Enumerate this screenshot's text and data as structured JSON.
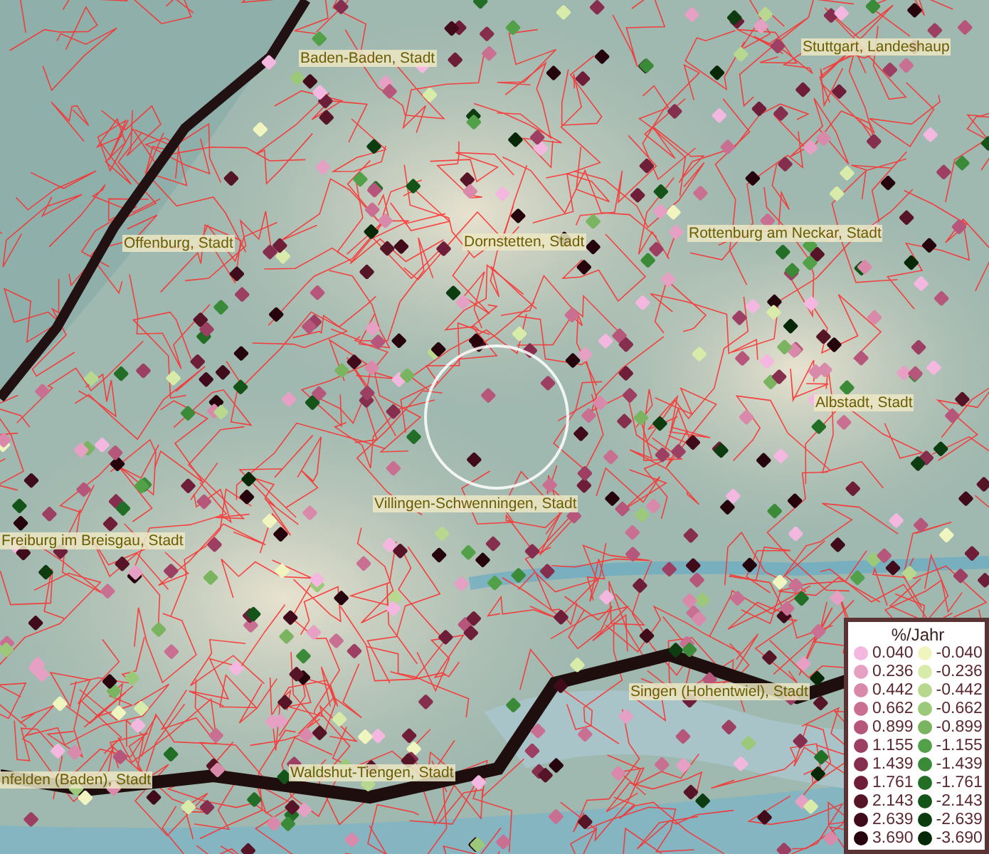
{
  "map": {
    "place_labels": [
      {
        "text": "Baden-Baden, Stadt"
      },
      {
        "text": "Stuttgart, Landeshaup"
      },
      {
        "text": "Offenburg, Stadt"
      },
      {
        "text": "Dornstetten, Stadt"
      },
      {
        "text": "Rottenburg am Neckar, Stadt"
      },
      {
        "text": "Albstadt, Stadt"
      },
      {
        "text": "Villingen-Schwenningen, Stadt"
      },
      {
        "text": "Freiburg im Breisgau, Stadt"
      },
      {
        "text": "Singen (Hohentwiel), Stadt"
      },
      {
        "text": "Waldshut-Tiengen, Stadt"
      },
      {
        "text": "nfelden (Baden), Stadt"
      }
    ]
  },
  "legend": {
    "title": "%/Jahr",
    "rows": [
      {
        "positive": {
          "label": "0.040",
          "color": "#f4b8e0"
        },
        "negative": {
          "label": "-0.040",
          "color": "#f0f5c0"
        }
      },
      {
        "positive": {
          "label": "0.236",
          "color": "#e6a0c4"
        },
        "negative": {
          "label": "-0.236",
          "color": "#d8eba8"
        }
      },
      {
        "positive": {
          "label": "0.442",
          "color": "#d98aab"
        },
        "negative": {
          "label": "-0.442",
          "color": "#b8d890"
        }
      },
      {
        "positive": {
          "label": "0.662",
          "color": "#c96f92"
        },
        "negative": {
          "label": "-0.662",
          "color": "#9cc87a"
        }
      },
      {
        "positive": {
          "label": "0.899",
          "color": "#b5567a"
        },
        "negative": {
          "label": "-0.899",
          "color": "#7ab460"
        }
      },
      {
        "positive": {
          "label": "1.155",
          "color": "#9c3f62"
        },
        "negative": {
          "label": "-1.155",
          "color": "#52a048"
        }
      },
      {
        "positive": {
          "label": "1.439",
          "color": "#862e4e"
        },
        "negative": {
          "label": "-1.439",
          "color": "#3a8a38"
        }
      },
      {
        "positive": {
          "label": "1.761",
          "color": "#6e1e38"
        },
        "negative": {
          "label": "-1.761",
          "color": "#226e26"
        }
      },
      {
        "positive": {
          "label": "2.143",
          "color": "#561427"
        },
        "negative": {
          "label": "-2.143",
          "color": "#155418"
        }
      },
      {
        "positive": {
          "label": "2.639",
          "color": "#400b1a"
        },
        "negative": {
          "label": "-2.639",
          "color": "#0c3c10"
        }
      },
      {
        "positive": {
          "label": "3.690",
          "color": "#26040d"
        },
        "negative": {
          "label": "-3.690",
          "color": "#062806"
        }
      }
    ]
  }
}
